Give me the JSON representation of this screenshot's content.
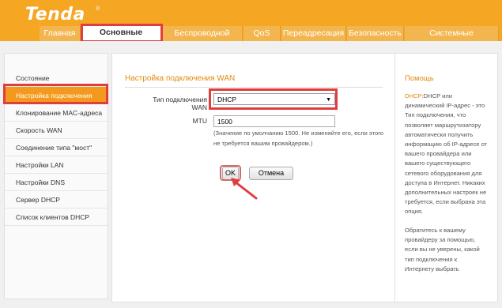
{
  "brand": {
    "logo": "Tenda",
    "mark": "®"
  },
  "nav": {
    "tabs": [
      {
        "label": "Главная"
      },
      {
        "label": "Основные настройки"
      },
      {
        "label": "Беспроводной режим"
      },
      {
        "label": "QoS"
      },
      {
        "label": "Переадресация"
      },
      {
        "label": "Безопасность"
      },
      {
        "label": "Системные инструменты"
      }
    ],
    "active_tab": 1
  },
  "sidebar": {
    "items": [
      {
        "label": "Состояние"
      },
      {
        "label": "Настройка подключения WAN"
      },
      {
        "label": "Клонирование MAC-адреса"
      },
      {
        "label": "Скорость WAN"
      },
      {
        "label": "Соединение типа \"мост\""
      },
      {
        "label": "Настройки LAN"
      },
      {
        "label": "Настройки DNS"
      },
      {
        "label": "Сервер DHCP"
      },
      {
        "label": "Список клиентов DHCP"
      }
    ],
    "active_item": 1
  },
  "main": {
    "title": "Настройка подключения WAN",
    "connection_type_label": "Тип подключения WAN",
    "connection_type_value": "DHCP",
    "mtu_label": "MTU",
    "mtu_value": "1500",
    "note_line1": "(Значение по умолчанию 1500. Не изменяйте его, если этого",
    "note_line2": "не требуется вашим провайдером.)",
    "ok_label": "OK",
    "cancel_label": "Отмена"
  },
  "help": {
    "title": "Помощь",
    "term": "DHCP",
    "lines": [
      ":DHCP или",
      "динамический IP-адрес - это",
      "Тип подключения, что",
      "позволяет маршрутизатору",
      "автоматически получить",
      "информацию об IP-адресе от",
      "вашего провайдера или",
      "вашего существующего",
      "сетевого оборудования для",
      "доступа в Интернет. Никаких",
      "дополнительных настроек не",
      "требуется, если выбрана эта",
      "опция."
    ],
    "lines2": [
      "Обратитесь к вашему",
      "провайдеру за помощью,",
      "если вы не уверены, какой",
      "тип подключения к",
      "Интернету выбрать"
    ]
  },
  "colors": {
    "header": "#f5a623",
    "accent": "#e08a0d",
    "highlight": "#e03d3d",
    "active_sidebar": "#f39a1e"
  }
}
